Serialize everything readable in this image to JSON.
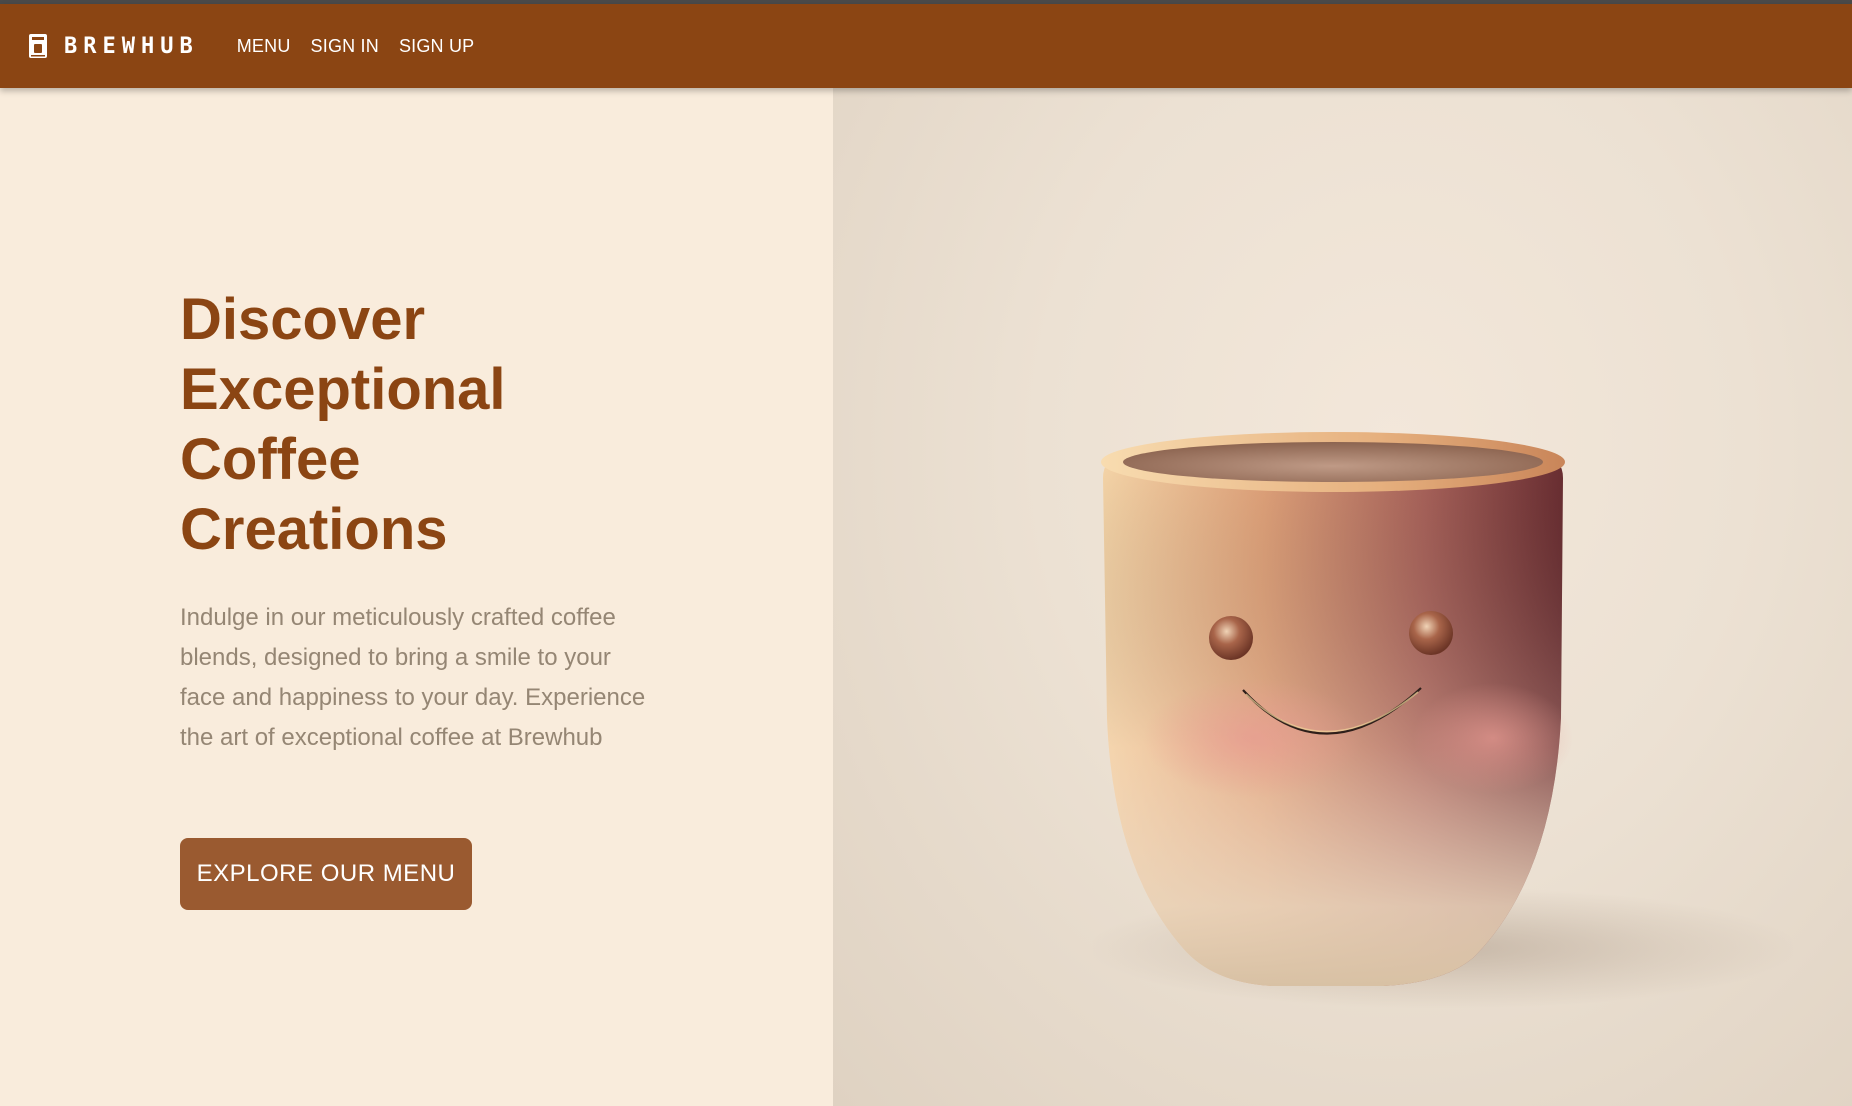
{
  "nav": {
    "brand": "BREWHUB",
    "brand_icon": "coffee-machine-icon",
    "links": [
      "MENU",
      "SIGN IN",
      "SIGN UP"
    ]
  },
  "hero": {
    "title_lines": [
      "Discover",
      "Exceptional",
      "Coffee",
      "Creations"
    ],
    "description": "Indulge in our meticulously crafted coffee blends, designed to bring a smile to your face and happiness to your day. Experience the art of exceptional coffee at Brewhub",
    "cta_label": "EXPLORE OUR MENU"
  },
  "colors": {
    "brand": "#8b4513",
    "cta": "#9a5a30",
    "background": "#f9ecdc",
    "body_text": "#958674"
  }
}
